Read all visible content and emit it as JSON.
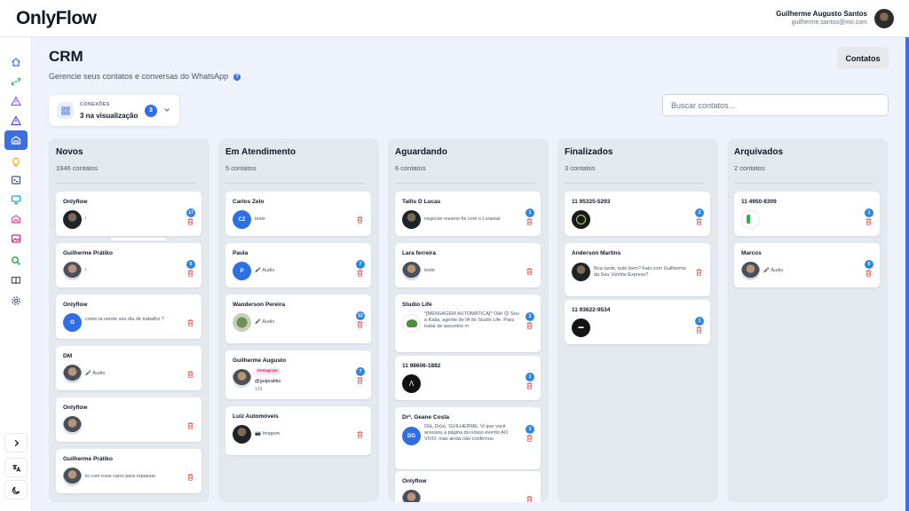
{
  "app": {
    "logo": "OnlyFlow",
    "user_name": "Guilherme Augusto Santos",
    "user_email": "guilherme.santos@mo.com"
  },
  "colors": {
    "accent": "#3b6fe0",
    "badge": "#2f86e0",
    "trash": "#ef4444",
    "instagram_tag": "#d0246b"
  },
  "sidebar": {
    "items": [
      {
        "icon": "home-icon"
      },
      {
        "icon": "link-icon"
      },
      {
        "icon": "alert-triangle-icon"
      },
      {
        "icon": "warning-triangle-icon"
      },
      {
        "icon": "crm-board-icon"
      },
      {
        "icon": "lightbulb-icon"
      },
      {
        "icon": "terminal-icon"
      },
      {
        "icon": "monitor-icon"
      },
      {
        "icon": "network-icon"
      },
      {
        "icon": "image-icon"
      },
      {
        "icon": "search-icon"
      },
      {
        "icon": "book-icon"
      },
      {
        "icon": "settings-icon"
      }
    ],
    "bottom": [
      {
        "icon": "chevron-right-icon"
      },
      {
        "icon": "translate-icon"
      },
      {
        "icon": "moon-icon"
      }
    ]
  },
  "page": {
    "title": "CRM",
    "subtitle": "Gerencie seus contatos e conversas do WhatsApp",
    "contacts_button": "Contatos",
    "connections_label": "CONEXÕES",
    "connections_value": "3 na visualização",
    "connections_badge": "3",
    "search_placeholder": "Buscar contatos..."
  },
  "columns": [
    {
      "title": "Novos",
      "count": "1946 contatos",
      "cards": [
        {
          "name": "Onlyflow",
          "preview": "!",
          "badge": "17"
        },
        {
          "name": "Guilherme Prátiko",
          "preview": "!",
          "badge": "5"
        },
        {
          "name": "Onlyflow",
          "initials": "O",
          "preview": "como ta sendo seu dia de trabalho ?"
        },
        {
          "name": "DM",
          "preview": "🎤 Áudio"
        },
        {
          "name": "Onlyflow",
          "preview": ""
        },
        {
          "name": "Guilherme Prátiko",
          "preview": "to com esse carro para repassar"
        }
      ]
    },
    {
      "title": "Em Atendimento",
      "count": "5 contatos",
      "cards": [
        {
          "name": "Carlos Zelo",
          "initials": "CZ",
          "preview": "teste"
        },
        {
          "name": "Paula",
          "initials": "P",
          "preview": "🎤 Áudio",
          "badge": "7"
        },
        {
          "name": "Wanderson Pereira",
          "preview": "🎤 Áudio",
          "badge": "12"
        },
        {
          "name": "Guilherme Augusto",
          "tag": "Instagram",
          "handle": "@guipratiko",
          "sub": "123",
          "badge": "7"
        },
        {
          "name": "Luiz Automóveis",
          "preview": "📷 Imagem"
        }
      ]
    },
    {
      "title": "Aguardando",
      "count": "6 contatos",
      "cards": [
        {
          "name": "Tallis D Lucas",
          "preview": "negociei mesmo foi com o Luramar",
          "badge": "1"
        },
        {
          "name": "Lara ferreira",
          "preview": "teste"
        },
        {
          "name": "Studio Life",
          "preview": "*[MENSAGEM AUTOMÁTICA]* Olá! 😊 Sou a Katia, agente de IA do Studio Life. Para tratar de assuntos m",
          "badge": "2"
        },
        {
          "name": "11 98606-1882",
          "preview": "",
          "badge": "1"
        },
        {
          "name": "Drª. Geane Costa",
          "initials": "DG",
          "preview": "Olá, Dr(a). GUILHERME. Vi que você acessou a página do nosso evento AO VIVO, mas ainda não confirmou",
          "badge": "3"
        },
        {
          "name": "Onlyflow",
          "preview": ""
        }
      ]
    },
    {
      "title": "Finalizados",
      "count": "3 contatos",
      "cards": [
        {
          "name": "11 95325-5293",
          "preview": "",
          "badge": "2"
        },
        {
          "name": "Anderson Martins",
          "preview": "Boa tarde, tudo bem? Falo com Guilherme da Seu Vizinho Express?"
        },
        {
          "name": "11 93622-9534",
          "preview": "",
          "badge": "1"
        }
      ]
    },
    {
      "title": "Arquivados",
      "count": "2 contatos",
      "cards": [
        {
          "name": "11 4950-8309",
          "preview": "",
          "badge": "1"
        },
        {
          "name": "Marcos",
          "preview": "🎤 Áudio",
          "badge": "6"
        }
      ]
    }
  ]
}
